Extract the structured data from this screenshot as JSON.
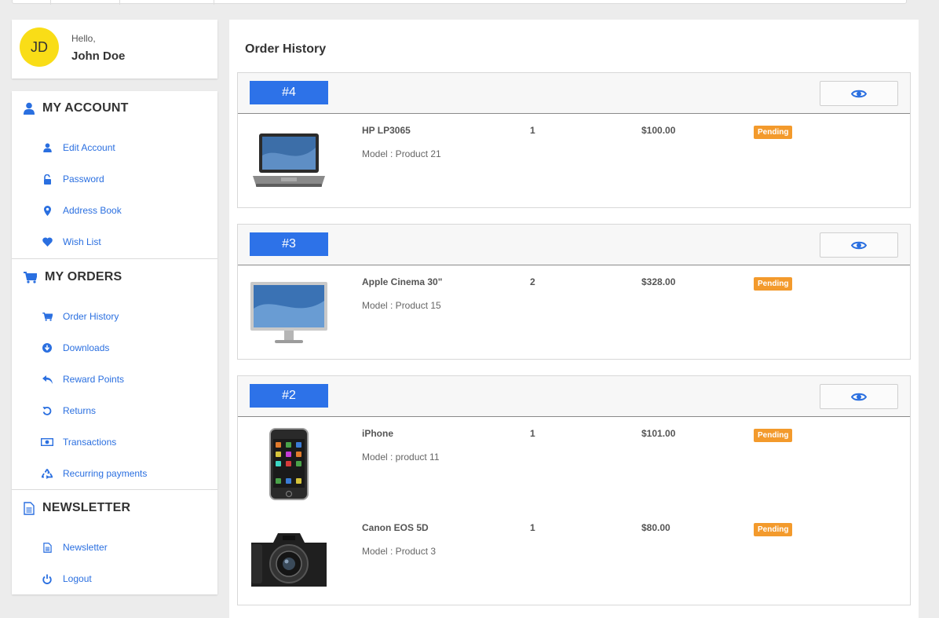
{
  "user": {
    "initials": "JD",
    "greeting": "Hello,",
    "name": "John Doe"
  },
  "colors": {
    "accent": "#2d72e8",
    "link": "#2a6fe0",
    "avatar": "#f9dd17",
    "status_pending": "#f39a2c"
  },
  "sidebar": {
    "account": {
      "title": "MY ACCOUNT",
      "icon": "user-icon",
      "items": [
        {
          "label": "Edit Account",
          "icon": "user-icon"
        },
        {
          "label": "Password",
          "icon": "unlock-icon"
        },
        {
          "label": "Address Book",
          "icon": "map-marker-icon"
        },
        {
          "label": "Wish List",
          "icon": "heart-icon"
        }
      ]
    },
    "orders": {
      "title": "MY ORDERS",
      "icon": "cart-icon",
      "items": [
        {
          "label": "Order History",
          "icon": "cart-icon"
        },
        {
          "label": "Downloads",
          "icon": "download-icon"
        },
        {
          "label": "Reward Points",
          "icon": "reply-icon"
        },
        {
          "label": "Returns",
          "icon": "undo-icon"
        },
        {
          "label": "Transactions",
          "icon": "money-icon"
        },
        {
          "label": "Recurring payments",
          "icon": "recycle-icon"
        }
      ]
    },
    "newsletter": {
      "title": "NEWSLETTER",
      "icon": "document-icon",
      "items": [
        {
          "label": "Newsletter",
          "icon": "document-icon"
        },
        {
          "label": "Logout",
          "icon": "power-icon"
        }
      ]
    }
  },
  "main": {
    "title": "Order History",
    "orders": [
      {
        "id": "#4",
        "products": [
          {
            "name": "HP LP3065",
            "model": "Model : Product 21",
            "qty": "1",
            "price": "$100.00",
            "status": "Pending",
            "image": "laptop"
          }
        ]
      },
      {
        "id": "#3",
        "products": [
          {
            "name": "Apple Cinema 30\"",
            "model": "Model : Product 15",
            "qty": "2",
            "price": "$328.00",
            "status": "Pending",
            "image": "monitor"
          }
        ]
      },
      {
        "id": "#2",
        "products": [
          {
            "name": "iPhone",
            "model": "Model : product 11",
            "qty": "1",
            "price": "$101.00",
            "status": "Pending",
            "image": "phone"
          },
          {
            "name": "Canon EOS 5D",
            "model": "Model : Product 3",
            "qty": "1",
            "price": "$80.00",
            "status": "Pending",
            "image": "camera"
          }
        ]
      }
    ]
  }
}
